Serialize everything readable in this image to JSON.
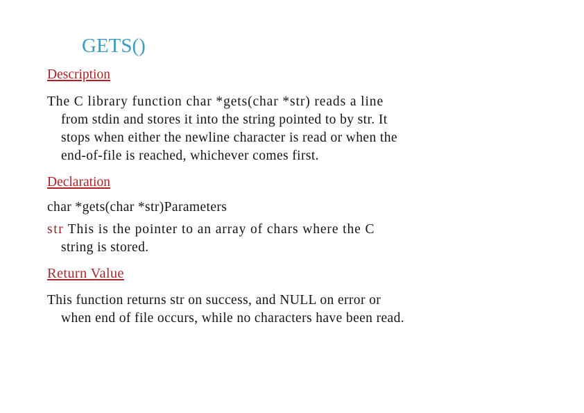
{
  "slide": {
    "title": "GETS()",
    "title_color": "#3e9bc0",
    "background_color": "#ffffff",
    "heading_color": "#b01f22",
    "body_color": "#141414",
    "code_accent_color": "#8e2226"
  },
  "sections": {
    "description": {
      "heading": "Description",
      "lines": [
        "The C library function char *gets(char *str) reads a line",
        "from stdin and stores it into the string pointed to by str. It",
        "stops when either the newline character is read or when  the",
        "end-of-file is reached, whichever comes first."
      ]
    },
    "declaration": {
      "heading": "Declaration",
      "signature": "char *gets(char *str)Parameters",
      "param_name": "str",
      "param_lines": [
        "This is the pointer to an array of chars where the C",
        "string is stored."
      ]
    },
    "return_value": {
      "heading": "Return Value",
      "lines": [
        "This function returns str on success, and NULL on error or",
        "when end of file occurs, while no characters have been  read."
      ]
    }
  }
}
